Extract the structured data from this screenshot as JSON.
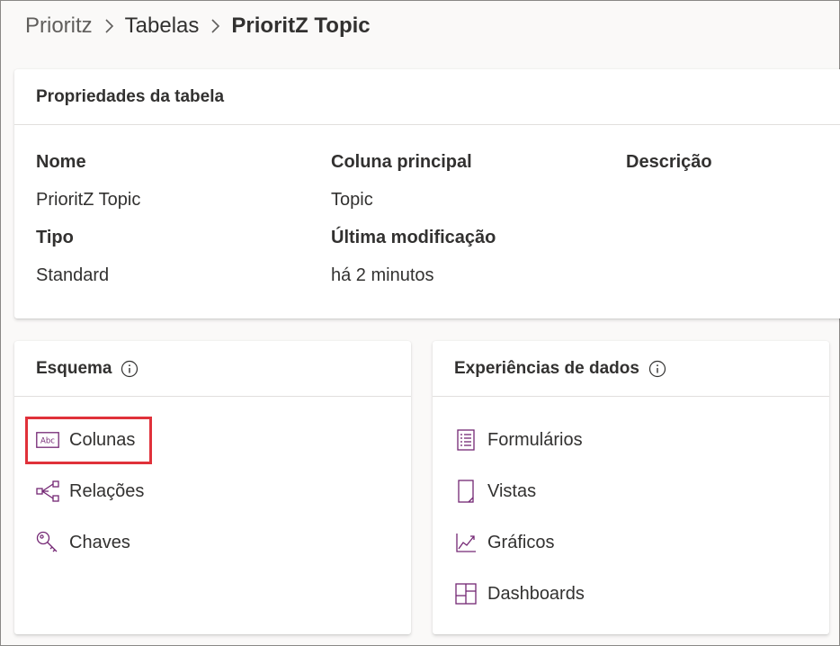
{
  "breadcrumb": {
    "items": [
      "Prioritz",
      "Tabelas",
      "PrioritZ Topic"
    ]
  },
  "properties": {
    "title": "Propriedades da tabela",
    "name_label": "Nome",
    "name_value": "PrioritZ Topic",
    "type_label": "Tipo",
    "type_value": "Standard",
    "primary_column_label": "Coluna principal",
    "primary_column_value": "Topic",
    "last_modified_label": "Última modificação",
    "last_modified_value": "há 2 minutos",
    "description_label": "Descrição"
  },
  "schema": {
    "title": "Esquema",
    "items": [
      {
        "label": "Colunas",
        "icon": "abc-column-icon"
      },
      {
        "label": "Relações",
        "icon": "relationship-icon"
      },
      {
        "label": "Chaves",
        "icon": "key-icon"
      }
    ]
  },
  "data_experiences": {
    "title": "Experiências de dados",
    "items": [
      {
        "label": "Formulários",
        "icon": "form-icon"
      },
      {
        "label": "Vistas",
        "icon": "view-icon"
      },
      {
        "label": "Gráficos",
        "icon": "chart-icon"
      },
      {
        "label": "Dashboards",
        "icon": "dashboard-icon"
      }
    ]
  },
  "colors": {
    "accent_icon": "#742774",
    "highlight": "#e0313a"
  }
}
